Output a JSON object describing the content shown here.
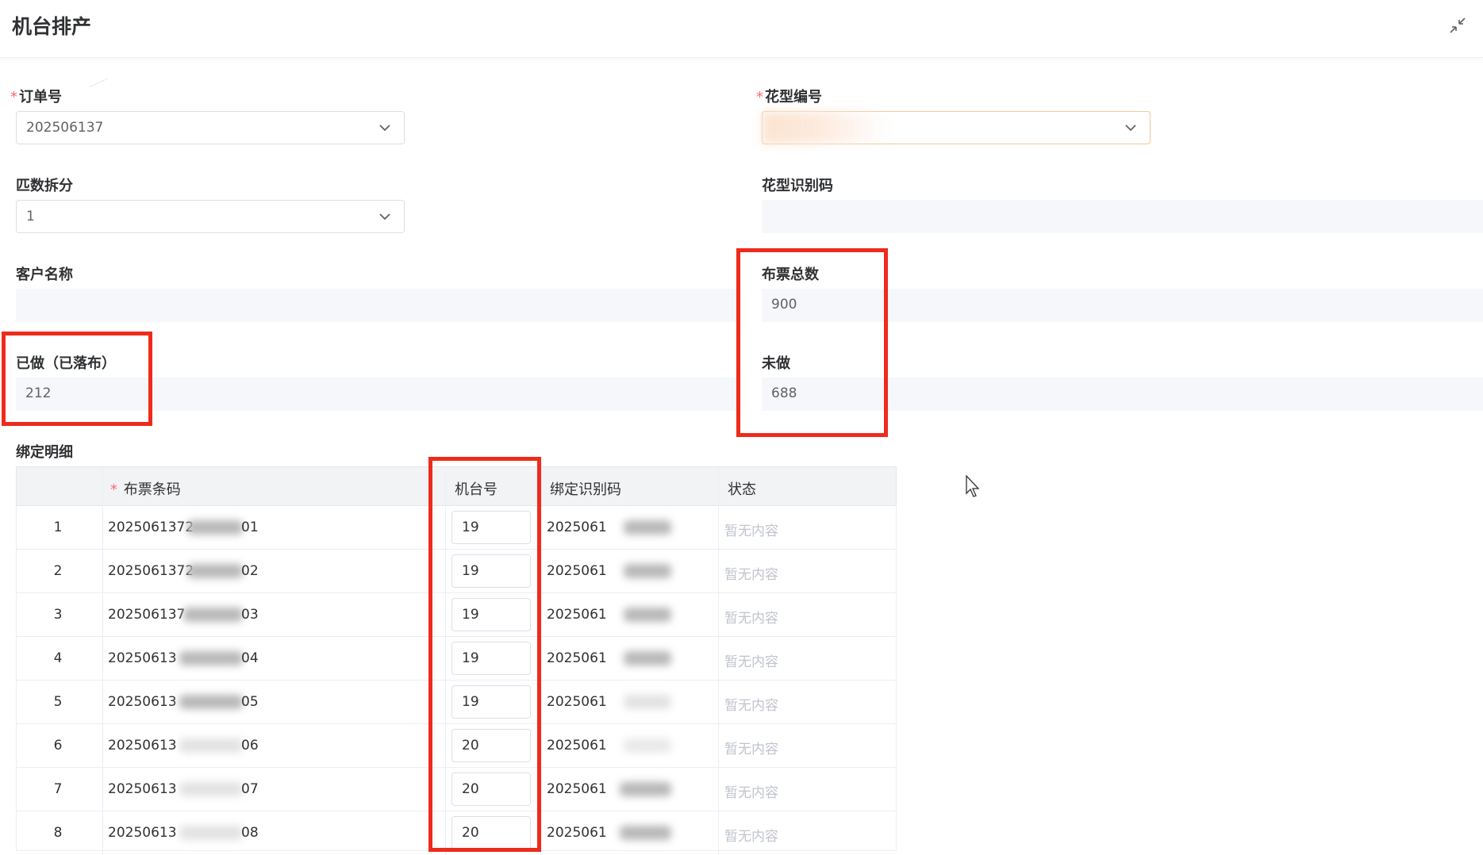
{
  "header": {
    "title": "机台排产"
  },
  "form": {
    "order_no": {
      "label": "订单号",
      "value": "202506137"
    },
    "pattern_no": {
      "label": "花型编号"
    },
    "split_count": {
      "label": "匹数拆分",
      "value": "1"
    },
    "pattern_code": {
      "label": "花型识别码"
    },
    "customer_name": {
      "label": "客户名称"
    },
    "ticket_total": {
      "label": "布票总数",
      "value": "900"
    },
    "done": {
      "label": "已做（已落布）",
      "value": "212"
    },
    "not_done": {
      "label": "未做",
      "value": "688"
    }
  },
  "binding": {
    "title": "绑定明细",
    "columns": [
      "布票条码",
      "机台号",
      "绑定识别码",
      "状态"
    ],
    "rows": [
      {
        "index": "1",
        "barcode_prefix": "2025061372",
        "barcode_suffix": "01",
        "machine": "19",
        "bind_prefix": "2025061",
        "status": "暂无内容"
      },
      {
        "index": "2",
        "barcode_prefix": "2025061372",
        "barcode_suffix": "02",
        "machine": "19",
        "bind_prefix": "2025061",
        "status": "暂无内容"
      },
      {
        "index": "3",
        "barcode_prefix": "202506137",
        "barcode_suffix": "03",
        "machine": "19",
        "bind_prefix": "2025061",
        "status": "暂无内容"
      },
      {
        "index": "4",
        "barcode_prefix": "20250613",
        "barcode_suffix": "04",
        "machine": "19",
        "bind_prefix": "2025061",
        "status": "暂无内容"
      },
      {
        "index": "5",
        "barcode_prefix": "20250613",
        "barcode_suffix": "05",
        "machine": "19",
        "bind_prefix": "2025061",
        "status": "暂无内容"
      },
      {
        "index": "6",
        "barcode_prefix": "20250613",
        "barcode_suffix": "06",
        "machine": "20",
        "bind_prefix": "2025061",
        "status": "暂无内容"
      },
      {
        "index": "7",
        "barcode_prefix": "20250613",
        "barcode_suffix": "07",
        "machine": "20",
        "bind_prefix": "2025061",
        "status": "暂无内容"
      },
      {
        "index": "8",
        "barcode_prefix": "20250613",
        "barcode_suffix": "08",
        "machine": "20",
        "bind_prefix": "2025061",
        "status": "暂无内容"
      }
    ]
  },
  "colors": {
    "highlight": "#ee2b1c",
    "required": "#f56c6c",
    "empty_text": "#c0c4cc"
  },
  "icons": {
    "collapse": "shrink-icon",
    "dropdown": "chevron-down-icon",
    "cursor": "mouse-pointer-icon"
  }
}
